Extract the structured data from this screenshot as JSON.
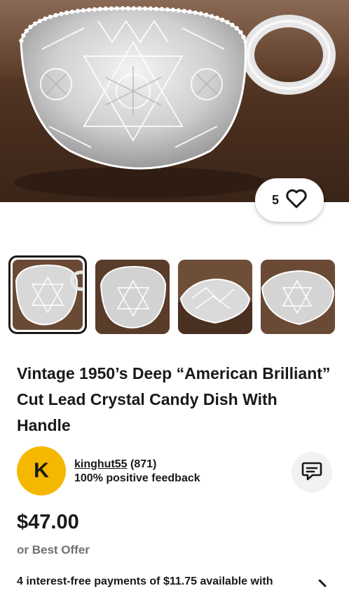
{
  "gallery": {
    "like_count": "5",
    "thumbnails": [
      {
        "label": "thumbnail-1",
        "selected": true
      },
      {
        "label": "thumbnail-2",
        "selected": false
      },
      {
        "label": "thumbnail-3",
        "selected": false
      },
      {
        "label": "thumbnail-4",
        "selected": false
      }
    ]
  },
  "listing": {
    "title": "Vintage 1950’s Deep “American Brilliant” Cut Lead Crystal Candy Dish With Handle",
    "price": "$47.00",
    "offer_text": "or Best Offer",
    "installments_text": "4 interest-free payments of $11.75 available with"
  },
  "seller": {
    "initial": "K",
    "username": "kinghut55",
    "rating_count": "(871)",
    "feedback": "100% positive feedback",
    "avatar_color": "#f5b800"
  },
  "icons": {
    "heart": "heart-icon",
    "message": "message-icon",
    "chevron": "chevron-right-icon"
  }
}
